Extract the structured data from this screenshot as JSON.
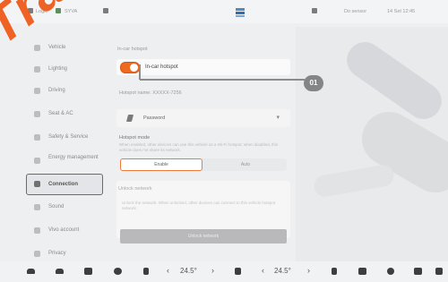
{
  "statusbar": {
    "left1": "Logic",
    "left2": "SYVA",
    "right1": "Do sensor",
    "right2": "14 Set 12:45",
    "icons": [
      "bluetooth-icon",
      "signal-icon",
      "folder-icon",
      "app-logo"
    ]
  },
  "sidebar": {
    "items": [
      {
        "label": "Vehicle",
        "icon": "vehicle-icon"
      },
      {
        "label": "Lighting",
        "icon": "bulb-icon"
      },
      {
        "label": "Driving",
        "icon": "steering-icon"
      },
      {
        "label": "Seat & AC",
        "icon": "seat-icon"
      },
      {
        "label": "Safety & Service",
        "icon": "shield-icon"
      },
      {
        "label": "Energy management",
        "icon": "battery-icon"
      },
      {
        "label": "Connection",
        "icon": "link-icon",
        "active": true
      },
      {
        "label": "Sound",
        "icon": "speaker-icon"
      },
      {
        "label": "Vivo account",
        "icon": "user-icon"
      },
      {
        "label": "Privacy",
        "icon": "lock-icon"
      }
    ]
  },
  "watermark": "Trafford",
  "panel": {
    "section_title": "In-car hotspot",
    "hotspot_label": "In-car hotspot",
    "hotspot_on": true,
    "hotspot_name": "Hotspot name: XXXXX-7256",
    "password_label": "Password",
    "mode_title": "Hotspot mode",
    "mode_desc": "When enabled, other devices can use this vehicle as a Wi-Fi hotspot; when disabled, this vehicle does not share its network.",
    "mode_options": [
      "Enable",
      "Auto"
    ],
    "unlock_title": "Unlock network",
    "unlock_desc": "Unlock the network. When unlocked, other devices can connect to this vehicle hotspot network.",
    "unlock_button": "Unlock network"
  },
  "callout": {
    "number": "01"
  },
  "dock": {
    "temp_left": "24.5°",
    "temp_right": "24.5°",
    "icons": [
      "home-icon",
      "car-icon",
      "seat-heat-icon",
      "fan-icon",
      "phone-icon",
      "ac-icon",
      "seat-icon",
      "navigation-icon",
      "camera-icon",
      "music-icon",
      "apps-icon"
    ]
  },
  "colors": {
    "accent": "#ee6a1f",
    "active_border": "#6b6b6b"
  }
}
